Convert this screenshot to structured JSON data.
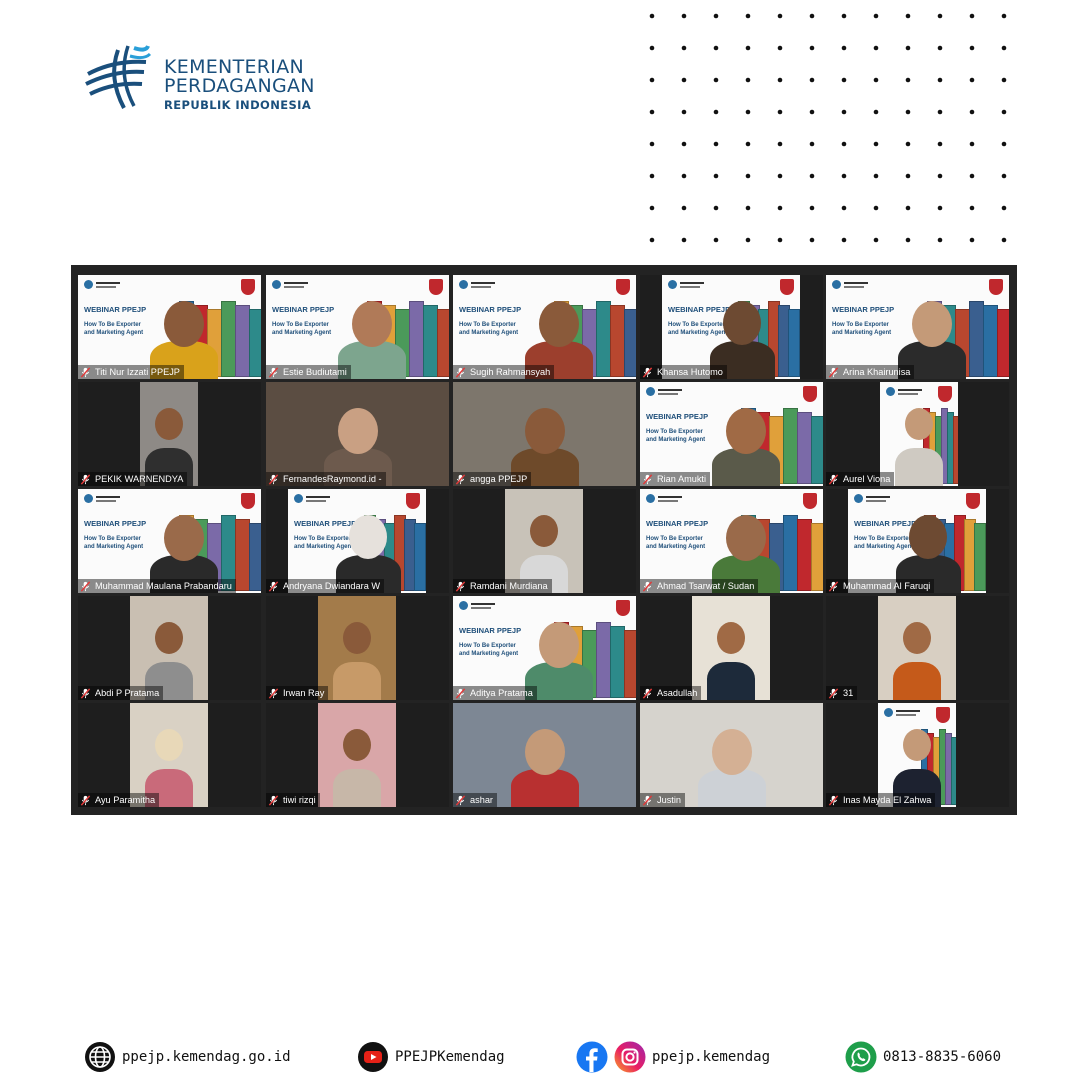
{
  "brand": {
    "line1": "KEMENTERIAN",
    "line2": "PERDAGANGAN",
    "line3": "REPUBLIK INDONESIA",
    "color": "#1a4f7c",
    "accent": "#2a9fd8"
  },
  "slide": {
    "title": "WEBINAR PPEJP",
    "subtitle": "How To Be Exporter\nand Marketing Agent"
  },
  "active_speaker_color": "#d7e64a",
  "participants": [
    {
      "name": "Titi Nur Izzati PPEJP",
      "active": true
    },
    {
      "name": "Estie Budiutami"
    },
    {
      "name": "Sugih Rahmansyah"
    },
    {
      "name": "Khansa Hutomo"
    },
    {
      "name": "Arina Khairunisa"
    },
    {
      "name": "PEKIK WARNENDYA"
    },
    {
      "name": "FernandesRaymond.id -"
    },
    {
      "name": "angga PPEJP"
    },
    {
      "name": "Rian Amukti"
    },
    {
      "name": "Aurel Viona"
    },
    {
      "name": "Muhammad Maulana Prabandaru"
    },
    {
      "name": "Andryana Dwiandara W"
    },
    {
      "name": "Ramdani Murdiana"
    },
    {
      "name": "Ahmad Tsarwat / Sudan"
    },
    {
      "name": "Muhammad Al Faruqi"
    },
    {
      "name": "Abdi P Pratama"
    },
    {
      "name": "Irwan Ray"
    },
    {
      "name": "Aditya Pratama"
    },
    {
      "name": "Asadullah"
    },
    {
      "name": "31"
    },
    {
      "name": "Ayu Paramitha"
    },
    {
      "name": "tiwi rizqi"
    },
    {
      "name": "ashar"
    },
    {
      "name": "Justin"
    },
    {
      "name": "Inas Mayda El Zahwa"
    }
  ],
  "footer": {
    "website": "ppejp.kemendag.go.id",
    "youtube": "PPEJPKemendag",
    "social": "ppejp.kemendag",
    "whatsapp": "0813-8835-6060",
    "icons": [
      "globe-icon",
      "youtube-icon",
      "facebook-icon",
      "instagram-icon",
      "whatsapp-icon"
    ]
  }
}
